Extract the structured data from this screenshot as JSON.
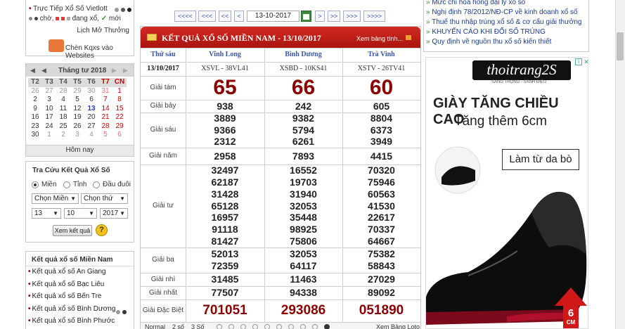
{
  "left": {
    "vietlott": {
      "label": "Trực Tiếp Xổ Số Vietlott",
      "legend_wait": "chờ,",
      "legend_spin": "đang xổ,",
      "legend_new": "mới",
      "history_link": "Lịch Mở Thưởng",
      "embed_button": "Chèn Kqxs vào Websites"
    },
    "calendar": {
      "month_label": "Tháng tư 2018",
      "nav_prev_year": "◀",
      "nav_prev": "◀",
      "nav_next": "▶",
      "nav_next_year": "▶",
      "weekdays": [
        "T2",
        "T3",
        "T4",
        "T5",
        "T6",
        "T7",
        "CN"
      ],
      "weeks": [
        [
          "26",
          "27",
          "28",
          "29",
          "30",
          "31",
          "1"
        ],
        [
          "2",
          "3",
          "4",
          "5",
          "6",
          "7",
          "8"
        ],
        [
          "9",
          "10",
          "11",
          "12",
          "13",
          "14",
          "15"
        ],
        [
          "16",
          "17",
          "18",
          "19",
          "20",
          "21",
          "22"
        ],
        [
          "23",
          "24",
          "25",
          "26",
          "27",
          "28",
          "29"
        ],
        [
          "30",
          "1",
          "2",
          "3",
          "4",
          "5",
          "6"
        ]
      ],
      "today_label": "Hôm nay"
    },
    "lookup": {
      "title": "Tra Cứu Kết Quả Xổ Số",
      "radio_mien": "Miền",
      "radio_tinh": "Tỉnh",
      "radio_dauduoi": "Đầu đuôi",
      "select_mien": "Chọn Miền",
      "select_thu": "Chọn thứ",
      "day": "13",
      "month": "10",
      "year": "2017",
      "submit": "Xem kết quả",
      "help": "?"
    },
    "mien_nam": {
      "title": "Kết quả xổ số Miền Nam",
      "items": [
        "Kết quả xổ số An Giang",
        "Kết quả xổ số Bạc Liêu",
        "Kết quả xổ số Bến Tre",
        "Kết quả xổ số Bình Dương",
        "Kết quả xổ số Bình Phước"
      ]
    }
  },
  "nav": {
    "first": "<<<<",
    "prev3": "<<<",
    "prev2": "<<",
    "prev": "<",
    "date": "13-10-2017",
    "next": ">",
    "next2": ">>",
    "next3": ">>>",
    "last": ">>>>"
  },
  "result": {
    "title": "KẾT QUẢ XỔ SỐ MIỀN NAM - 13/10/2017",
    "view_table": "Xem bảng tính...",
    "weekday": "Thứ sáu",
    "date": "13/10/2017",
    "provinces": [
      {
        "name": "Vĩnh Long",
        "code": "XSVL - 38VL41"
      },
      {
        "name": "Bình Dương",
        "code": "XSBD - 10KS41"
      },
      {
        "name": "Trà Vinh",
        "code": "XSTV - 26TV41"
      }
    ],
    "prizes": [
      {
        "label": "Giải tám",
        "values": [
          [
            "65"
          ],
          [
            "66"
          ],
          [
            "60"
          ]
        ]
      },
      {
        "label": "Giải bảy",
        "values": [
          [
            "938"
          ],
          [
            "242"
          ],
          [
            "605"
          ]
        ]
      },
      {
        "label": "Giải sáu",
        "values": [
          [
            "3889",
            "9366",
            "2312"
          ],
          [
            "9382",
            "5794",
            "6261"
          ],
          [
            "8804",
            "6373",
            "3949"
          ]
        ]
      },
      {
        "label": "Giải năm",
        "values": [
          [
            "2958"
          ],
          [
            "7893"
          ],
          [
            "4415"
          ]
        ]
      },
      {
        "label": "Giải tư",
        "values": [
          [
            "32497",
            "62187",
            "31428",
            "65128",
            "16957",
            "91118",
            "81427"
          ],
          [
            "16552",
            "19703",
            "31940",
            "32053",
            "35448",
            "98925",
            "75806"
          ],
          [
            "70320",
            "75946",
            "60563",
            "41530",
            "22617",
            "70337",
            "64667"
          ]
        ]
      },
      {
        "label": "Giải ba",
        "values": [
          [
            "52013",
            "72359"
          ],
          [
            "32053",
            "64117"
          ],
          [
            "75382",
            "58843"
          ]
        ]
      },
      {
        "label": "Giải nhì",
        "values": [
          [
            "31485"
          ],
          [
            "11463"
          ],
          [
            "27029"
          ]
        ]
      },
      {
        "label": "Giải nhất",
        "values": [
          [
            "77507"
          ],
          [
            "94338"
          ],
          [
            "89092"
          ]
        ]
      },
      {
        "label": "Giải Đặc Biệt",
        "values": [
          [
            "701051"
          ],
          [
            "293086"
          ],
          [
            "051890"
          ]
        ]
      }
    ],
    "footer": {
      "normal": "Normal",
      "two": "2 số",
      "three": "3 Số",
      "view_lotto": "Xem Bảng Loto"
    }
  },
  "news": [
    "Mức chi hoa hồng đại lý xổ số",
    "Nghị định 78/2012/NĐ-CP về kinh doanh xổ số",
    "Thuế thu nhập trúng xổ số & cơ cấu giải thưởng",
    "KHUYẾN CÁO KHI ĐỔI SỐ TRÚNG",
    "Quy định về nguồn thu xổ số kiến thiết"
  ],
  "ad": {
    "brand": "thoitrang2S",
    "brand_sub": "SANG TRỌNG - SÀNH ĐIỆU",
    "headline": "GIÀY TĂNG CHIỀU CAO",
    "subline": "Tăng thêm 6cm",
    "tag": "Làm từ da bò",
    "arrow_label_num": "6",
    "arrow_label_unit": "CM"
  },
  "colors": {
    "accent_red": "#8b0000",
    "header_red": "#c21e17",
    "link_blue": "#1a3d8a",
    "news_green": "#3c8a2c"
  }
}
